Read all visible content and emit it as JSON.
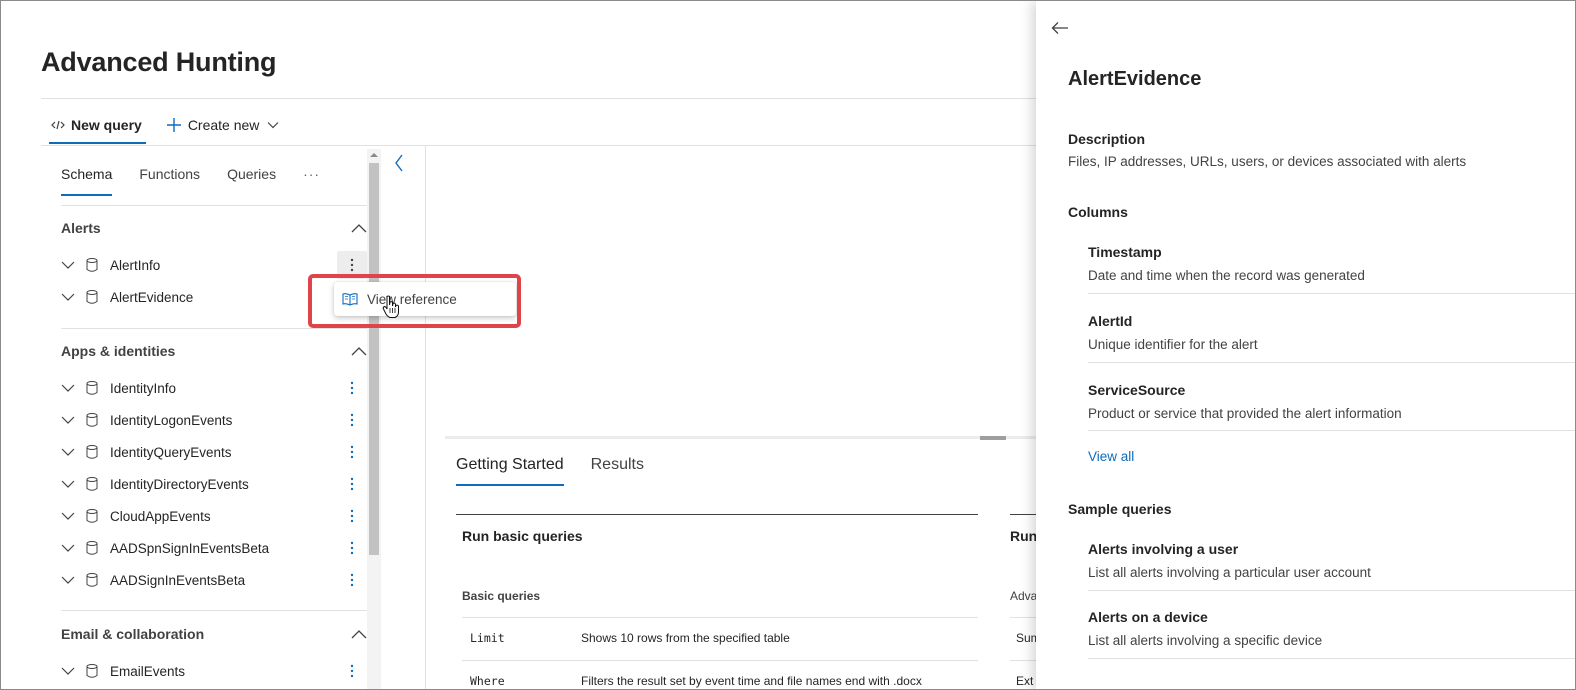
{
  "page": {
    "title": "Advanced Hunting"
  },
  "command_bar": {
    "new_query": "New query",
    "create_new": "Create new"
  },
  "schema_panel": {
    "tabs": [
      "Schema",
      "Functions",
      "Queries"
    ],
    "more": "···",
    "sections": [
      {
        "title": "Alerts",
        "tables": [
          "AlertInfo",
          "AlertEvidence"
        ]
      },
      {
        "title": "Apps & identities",
        "tables": [
          "IdentityInfo",
          "IdentityLogonEvents",
          "IdentityQueryEvents",
          "IdentityDirectoryEvents",
          "CloudAppEvents",
          "AADSpnSignInEventsBeta",
          "AADSignInEventsBeta"
        ]
      },
      {
        "title": "Email & collaboration",
        "tables": [
          "EmailEvents"
        ]
      }
    ]
  },
  "context_menu": {
    "item": "View reference"
  },
  "results_panel": {
    "tabs": [
      "Getting Started",
      "Results"
    ],
    "col1": {
      "heading": "Run basic queries",
      "subheading": "Basic queries",
      "rows": [
        {
          "code": "Limit",
          "desc": "Shows 10 rows from the specified table"
        },
        {
          "code": "Where",
          "desc": "Filters the result set by event time and file names end with .docx"
        }
      ]
    },
    "col2": {
      "heading": "Run",
      "subheading": "Adva",
      "rows": [
        "Sum",
        "Ext"
      ]
    }
  },
  "reference_panel": {
    "title": "AlertEvidence",
    "description_label": "Description",
    "description": "Files, IP addresses, URLs, users, or devices associated with alerts",
    "columns_label": "Columns",
    "columns": [
      {
        "name": "Timestamp",
        "desc": "Date and time when the record was generated"
      },
      {
        "name": "AlertId",
        "desc": "Unique identifier for the alert"
      },
      {
        "name": "ServiceSource",
        "desc": "Product or service that provided the alert information"
      }
    ],
    "view_all": "View all",
    "sample_queries_label": "Sample queries",
    "samples": [
      {
        "name": "Alerts involving a user",
        "desc": "List all alerts involving a particular user account"
      },
      {
        "name": "Alerts on a device",
        "desc": "List all alerts involving a specific device"
      }
    ]
  },
  "colors": {
    "accent": "#0f6cbd",
    "highlight": "#e0444b"
  }
}
